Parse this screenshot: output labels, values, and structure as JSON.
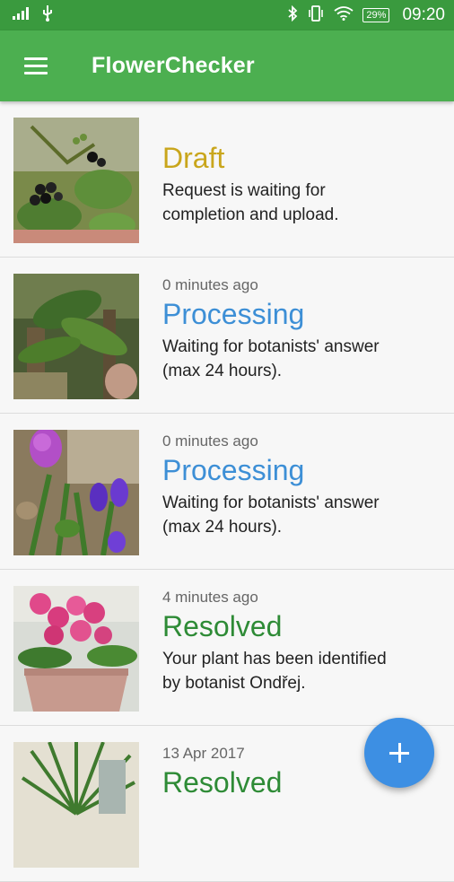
{
  "status_bar": {
    "signal_icon": "signal-bars-icon",
    "usb_icon": "usb-icon",
    "bluetooth_icon": "bluetooth-icon",
    "vibrate_icon": "vibrate-icon",
    "wifi_icon": "wifi-icon",
    "battery": "29%",
    "time": "09:20"
  },
  "app_bar": {
    "menu_icon": "hamburger-menu-icon",
    "title": "FlowerChecker",
    "background_color": "#4caf50"
  },
  "requests": [
    {
      "time": "",
      "status": "Draft",
      "status_color": "#c9a61c",
      "description": "Request is waiting for\ncompletion and upload."
    },
    {
      "time": "0 minutes ago",
      "status": "Processing",
      "status_color": "#3d8fd6",
      "description": "Waiting for botanists' answer\n(max 24 hours)."
    },
    {
      "time": "0 minutes ago",
      "status": "Processing",
      "status_color": "#3d8fd6",
      "description": "Waiting for botanists' answer\n(max 24 hours)."
    },
    {
      "time": "4 minutes ago",
      "status": "Resolved",
      "status_color": "#2e8b36",
      "description": "Your plant has been identified\nby botanist Ondřej."
    },
    {
      "time": "13 Apr 2017",
      "status": "Resolved",
      "status_color": "#2e8b36",
      "description": ""
    }
  ],
  "fab": {
    "icon": "plus-icon",
    "color": "#3d8fe3"
  }
}
